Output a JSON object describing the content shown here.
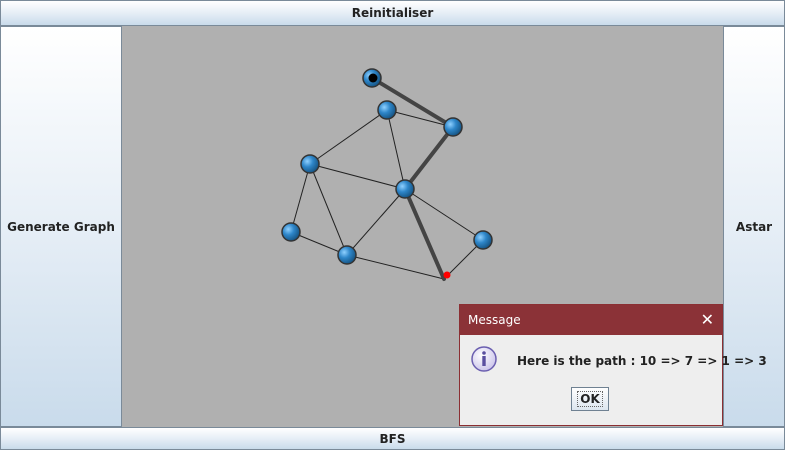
{
  "buttons": {
    "reinitialiser": "Reinitialiser",
    "generate_graph": "Generate Graph",
    "astar": "Astar",
    "bfs": "BFS"
  },
  "dialog": {
    "title": "Message",
    "message": "Here is the path : 10 => 7 => 1 => 3",
    "ok_label": "OK",
    "close_icon": "close-icon",
    "info_icon": "information-icon"
  },
  "colors": {
    "canvas_bg": "#b0b0b0",
    "node_fill": "#2e86c9",
    "edge": "#222222",
    "path_edge": "#444444",
    "start_marker": "#000000",
    "end_marker": "#ff0000",
    "dialog_title_bg": "#8b3237"
  }
}
